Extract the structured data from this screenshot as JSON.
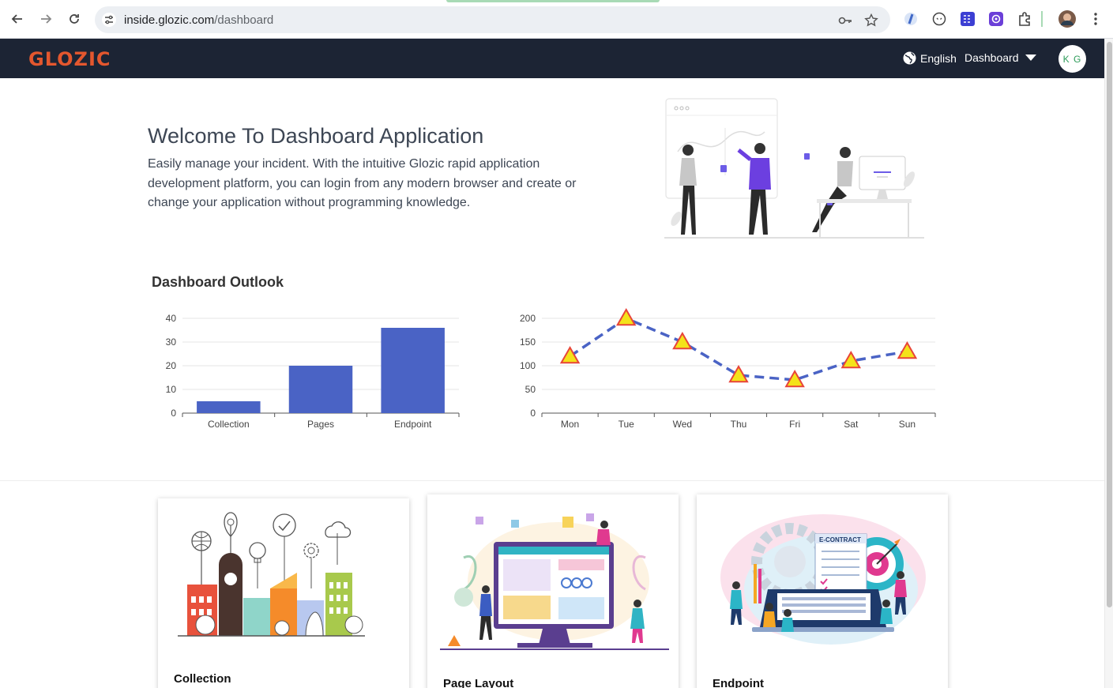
{
  "browser": {
    "url_host": "inside.glozic.com",
    "url_path": "/dashboard"
  },
  "header": {
    "logo": "GLOZIC",
    "language": "English",
    "menu": "Dashboard",
    "avatar_initials": "K G"
  },
  "welcome": {
    "title": "Welcome To Dashboard Application",
    "text": "Easily manage your incident. With the intuitive Glozic rapid application development platform, you can login from any modern browser and create or change your application without programming knowledge."
  },
  "outlook_title": "Dashboard Outlook",
  "chart_data": [
    {
      "type": "bar",
      "categories": [
        "Collection",
        "Pages",
        "Endpoint"
      ],
      "values": [
        5,
        20,
        36
      ],
      "ylim": [
        0,
        40
      ],
      "yticks": [
        0,
        10,
        20,
        30,
        40
      ],
      "color": "#4a63c5",
      "grid": true
    },
    {
      "type": "line",
      "categories": [
        "Mon",
        "Tue",
        "Wed",
        "Thu",
        "Fri",
        "Sat",
        "Sun"
      ],
      "values": [
        120,
        200,
        150,
        80,
        70,
        110,
        130
      ],
      "ylim": [
        0,
        200
      ],
      "yticks": [
        0,
        50,
        100,
        150,
        200
      ],
      "line_color": "#4a63c5",
      "marker": "triangle",
      "marker_fill": "#f4e21a",
      "marker_stroke": "#e8443a",
      "grid": true
    }
  ],
  "cards": [
    {
      "title": "Collection"
    },
    {
      "title": "Page Layout"
    },
    {
      "title": "Endpoint"
    }
  ],
  "card_art_text": {
    "contract": "E-CONTRACT"
  }
}
